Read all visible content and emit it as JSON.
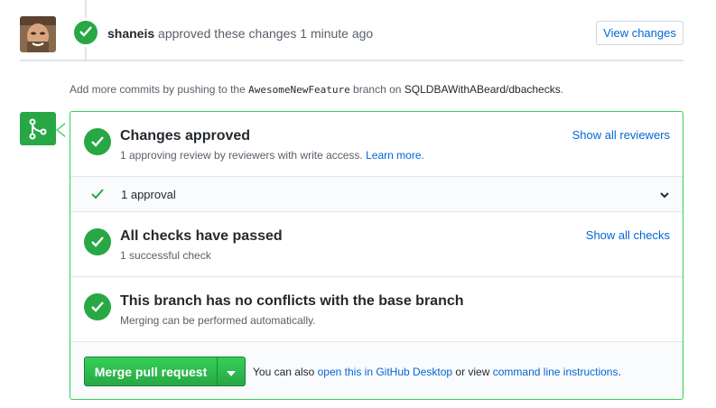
{
  "review": {
    "author": "shaneis",
    "action": "approved these changes",
    "time": "1 minute ago",
    "view_changes_label": "View changes"
  },
  "add_commits": {
    "prefix": "Add more commits by pushing to the",
    "branch": "AwesomeNewFeature",
    "middle": "branch on",
    "repo": "SQLDBAWithABeard/dbachecks",
    "suffix": "."
  },
  "merge_box": {
    "approved": {
      "title": "Changes approved",
      "subtitle": "1 approving review by reviewers with write access.",
      "learn_more": "Learn more.",
      "link": "Show all reviewers"
    },
    "approval": {
      "label": "1 approval"
    },
    "checks": {
      "title": "All checks have passed",
      "subtitle": "1 successful check",
      "link": "Show all checks"
    },
    "conflicts": {
      "title": "This branch has no conflicts with the base branch",
      "subtitle": "Merging can be performed automatically."
    },
    "merge": {
      "button_label": "Merge pull request",
      "note_prefix": "You can also",
      "desktop_link": "open this in GitHub Desktop",
      "note_middle": "or view",
      "cli_link": "command line instructions",
      "note_suffix": "."
    }
  },
  "colors": {
    "success": "#28a745",
    "link": "#0366d6",
    "border_success": "#34d058"
  },
  "icons": {
    "avatar": "user-avatar",
    "review_status": "check-icon",
    "merge": "git-merge-icon",
    "chevron": "chevron-down-icon",
    "dropdown": "caret-down-icon"
  }
}
